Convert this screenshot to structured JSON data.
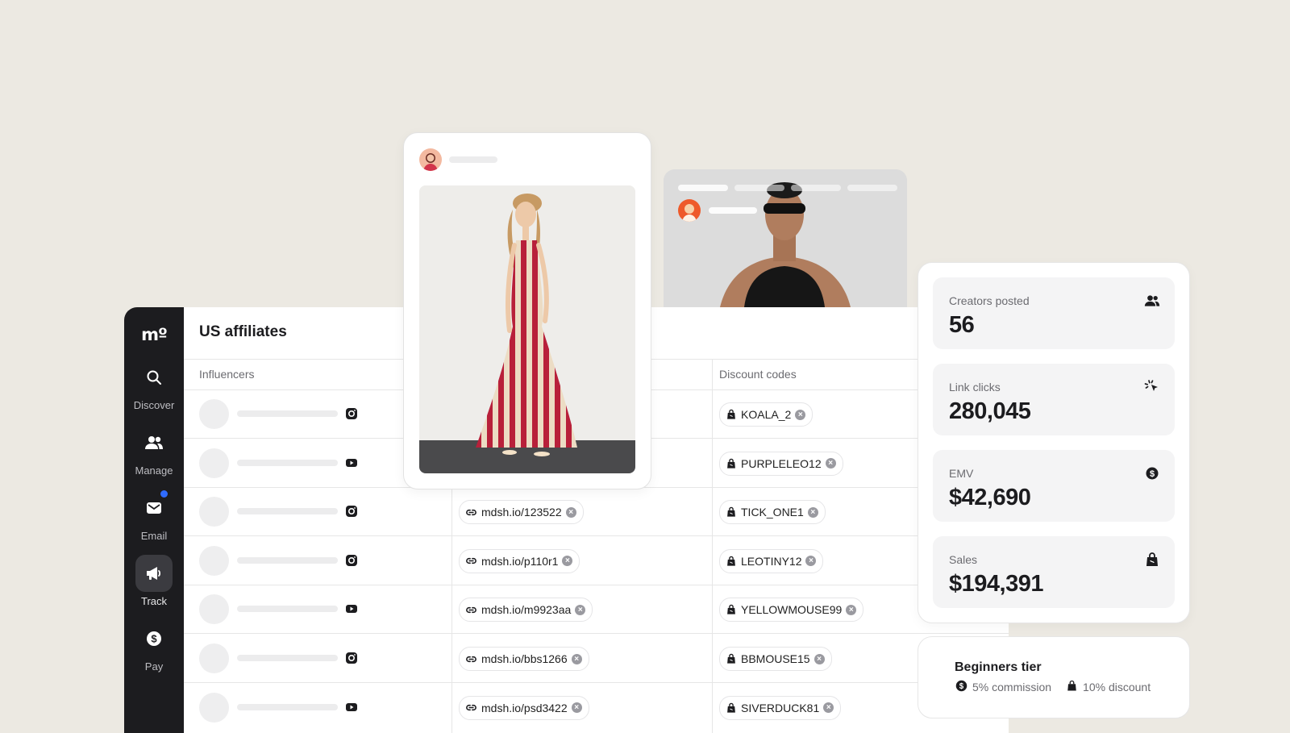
{
  "app": {
    "logo": "mº"
  },
  "sidebar": {
    "items": [
      {
        "label": "Discover",
        "icon": "search-icon"
      },
      {
        "label": "Manage",
        "icon": "users-icon"
      },
      {
        "label": "Email",
        "icon": "mail-icon",
        "notification": true
      },
      {
        "label": "Track",
        "icon": "megaphone-icon",
        "active": true
      },
      {
        "label": "Pay",
        "icon": "dollar-icon"
      }
    ]
  },
  "panel": {
    "title": "US affiliates",
    "columns": {
      "influencers": "Influencers",
      "discount_codes": "Discount codes"
    }
  },
  "rows": [
    {
      "platform": "instagram",
      "link": "",
      "code": "KOALA_2"
    },
    {
      "platform": "youtube",
      "link": "",
      "code": "PURPLELEO12"
    },
    {
      "platform": "instagram",
      "link": "mdsh.io/123522",
      "code": "TICK_ONE1"
    },
    {
      "platform": "instagram",
      "link": "mdsh.io/p110r1",
      "code": "LEOTINY12"
    },
    {
      "platform": "youtube",
      "link": "mdsh.io/m9923aa",
      "code": "YELLOWMOUSE99"
    },
    {
      "platform": "instagram",
      "link": "mdsh.io/bbs1266",
      "code": "BBMOUSE15"
    },
    {
      "platform": "youtube",
      "link": "mdsh.io/psd3422",
      "code": "SIVERDUCK81"
    }
  ],
  "stats": [
    {
      "label": "Creators posted",
      "value": "56",
      "icon": "users-icon"
    },
    {
      "label": "Link clicks",
      "value": "280,045",
      "icon": "click-icon"
    },
    {
      "label": "EMV",
      "value": "$42,690",
      "icon": "dollar-icon"
    },
    {
      "label": "Sales",
      "value": "$194,391",
      "icon": "shopping-bag-icon"
    }
  ],
  "tier": {
    "title": "Beginners tier",
    "commission": "5% commission",
    "discount": "10% discount"
  },
  "colors": {
    "sidebar": "#1c1c1f",
    "background": "#ece9e2",
    "notification": "#2f6bff",
    "dress_red": "#b8203a"
  }
}
